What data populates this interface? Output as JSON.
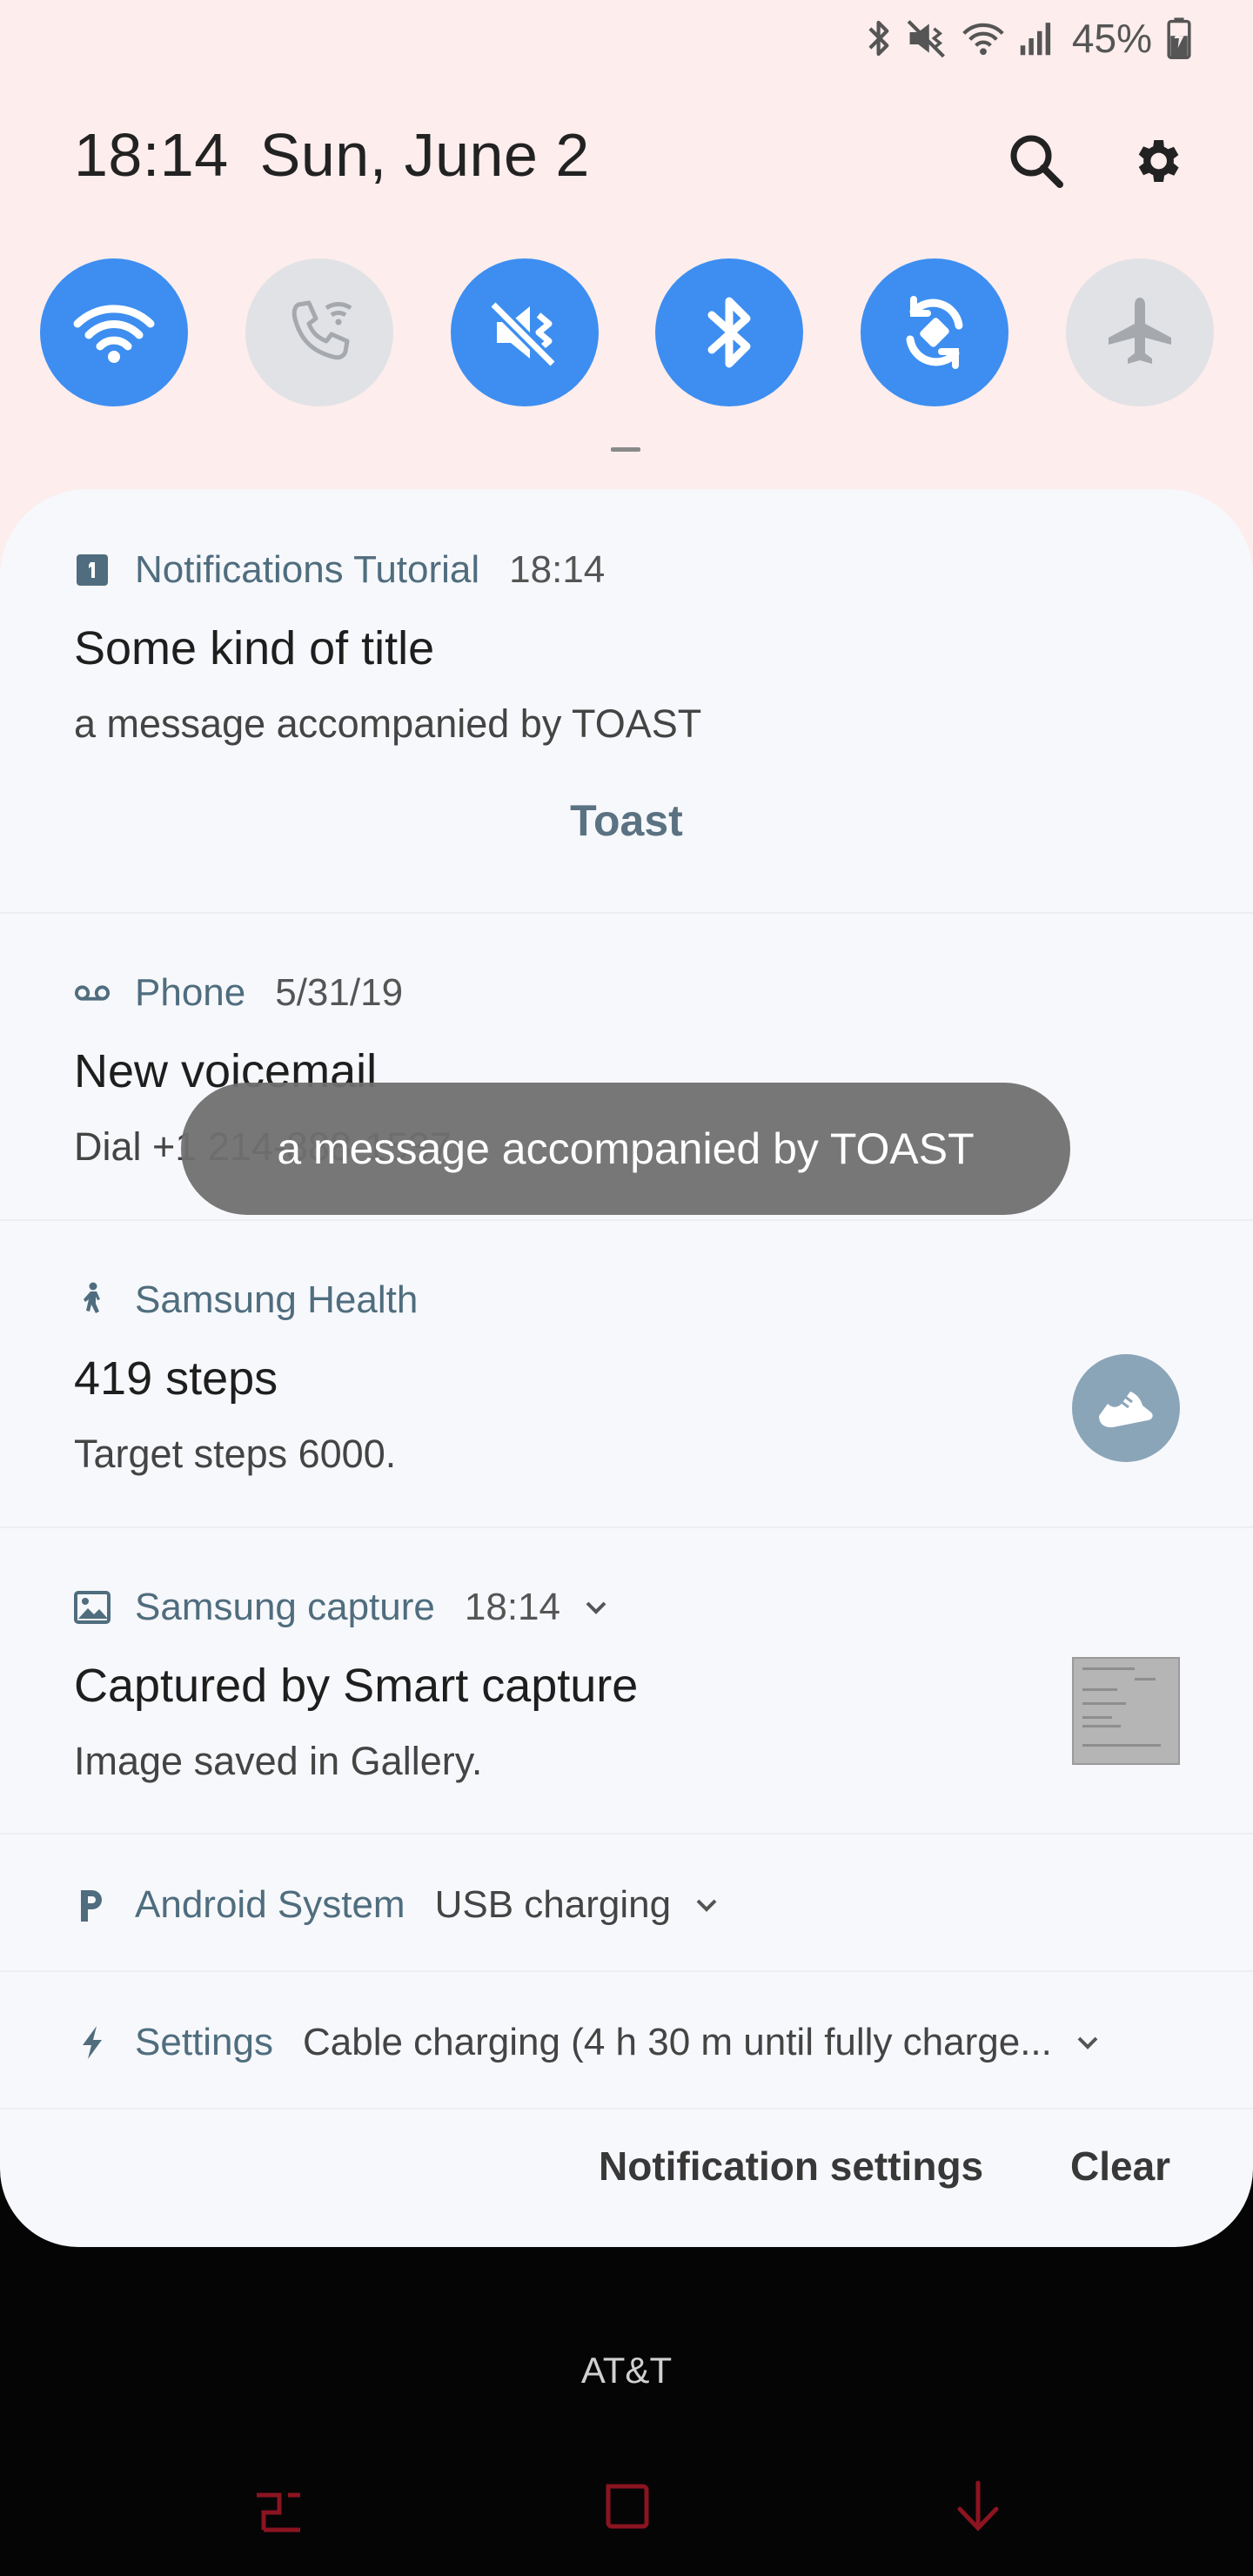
{
  "status_bar": {
    "battery": "45%",
    "icons": [
      "bluetooth-icon",
      "vibrate-mute-icon",
      "wifi-icon",
      "signal-icon",
      "battery-charging-icon"
    ]
  },
  "header": {
    "time": "18:14",
    "date": "Sun, June 2",
    "search_icon": "search-icon",
    "settings_icon": "gear-icon"
  },
  "quick_toggles": [
    {
      "name": "wifi",
      "icon": "wifi-icon",
      "on": true
    },
    {
      "name": "wifi-calling",
      "icon": "wifi-calling-icon",
      "on": false
    },
    {
      "name": "sound",
      "icon": "mute-icon",
      "on": true
    },
    {
      "name": "bluetooth",
      "icon": "bluetooth-icon",
      "on": true
    },
    {
      "name": "auto-rotate",
      "icon": "auto-rotate-icon",
      "on": true
    },
    {
      "name": "airplane-mode",
      "icon": "airplane-icon",
      "on": false
    }
  ],
  "notifications": [
    {
      "app": "Notifications Tutorial",
      "time": "18:14",
      "title": "Some kind of title",
      "text": "a message accompanied by TOAST",
      "action": "Toast"
    },
    {
      "app": "Phone",
      "time": "5/31/19",
      "title": "New voicemail",
      "text": "Dial +1 214-888-1537"
    },
    {
      "app": "Samsung Health",
      "title": "419 steps",
      "text": "Target steps 6000."
    },
    {
      "app": "Samsung capture",
      "time": "18:14",
      "title": "Captured by Smart capture",
      "text": "Image saved in Gallery."
    },
    {
      "app": "Android System",
      "text": "USB charging"
    },
    {
      "app": "Settings",
      "text": "Cable charging (4 h 30 m until fully charge..."
    }
  ],
  "footer": {
    "notification_settings": "Notification settings",
    "clear": "Clear"
  },
  "toast": {
    "text": "a message accompanied by TOAST"
  },
  "carrier": "AT&T",
  "colors": {
    "toggle_on": "#3d8ef0",
    "toggle_off": "#e1e2e5",
    "app_name": "#4f6d7e",
    "nav_buttons": "#8b1420",
    "shade_background": "#fdeded"
  }
}
